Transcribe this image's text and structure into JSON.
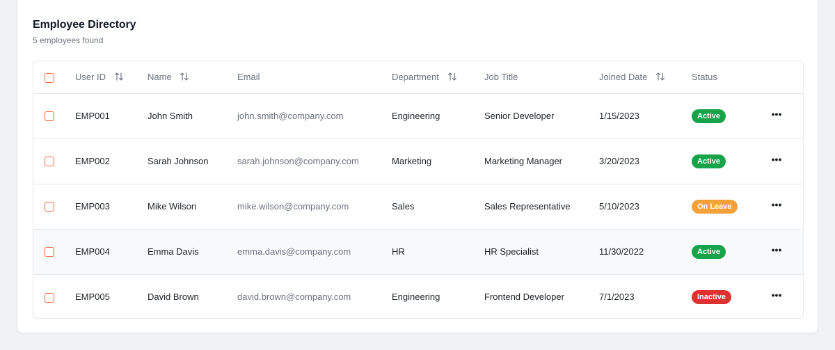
{
  "header": {
    "title": "Employee Directory",
    "subtitle": "5 employees found"
  },
  "columns": {
    "user_id": "User ID",
    "name": "Name",
    "email": "Email",
    "department": "Department",
    "job_title": "Job Title",
    "joined_date": "Joined Date",
    "status": "Status"
  },
  "colors": {
    "accent": "#f06a3a",
    "active": "#16a34a",
    "on_leave": "#f5a13a",
    "inactive": "#e03131"
  },
  "rows": [
    {
      "id": "EMP001",
      "name": "John Smith",
      "email": "john.smith@company.com",
      "department": "Engineering",
      "job_title": "Senior Developer",
      "joined": "1/15/2023",
      "status": "Active",
      "status_kind": "active"
    },
    {
      "id": "EMP002",
      "name": "Sarah Johnson",
      "email": "sarah.johnson@company.com",
      "department": "Marketing",
      "job_title": "Marketing Manager",
      "joined": "3/20/2023",
      "status": "Active",
      "status_kind": "active"
    },
    {
      "id": "EMP003",
      "name": "Mike Wilson",
      "email": "mike.wilson@company.com",
      "department": "Sales",
      "job_title": "Sales Representative",
      "joined": "5/10/2023",
      "status": "On Leave",
      "status_kind": "leave"
    },
    {
      "id": "EMP004",
      "name": "Emma Davis",
      "email": "emma.davis@company.com",
      "department": "HR",
      "job_title": "HR Specialist",
      "joined": "11/30/2022",
      "status": "Active",
      "status_kind": "active"
    },
    {
      "id": "EMP005",
      "name": "David Brown",
      "email": "david.brown@company.com",
      "department": "Engineering",
      "job_title": "Frontend Developer",
      "joined": "7/1/2023",
      "status": "Inactive",
      "status_kind": "inactive"
    }
  ],
  "icons": {
    "sort": "sort-arrows-icon",
    "more": "more-horizontal-icon"
  }
}
